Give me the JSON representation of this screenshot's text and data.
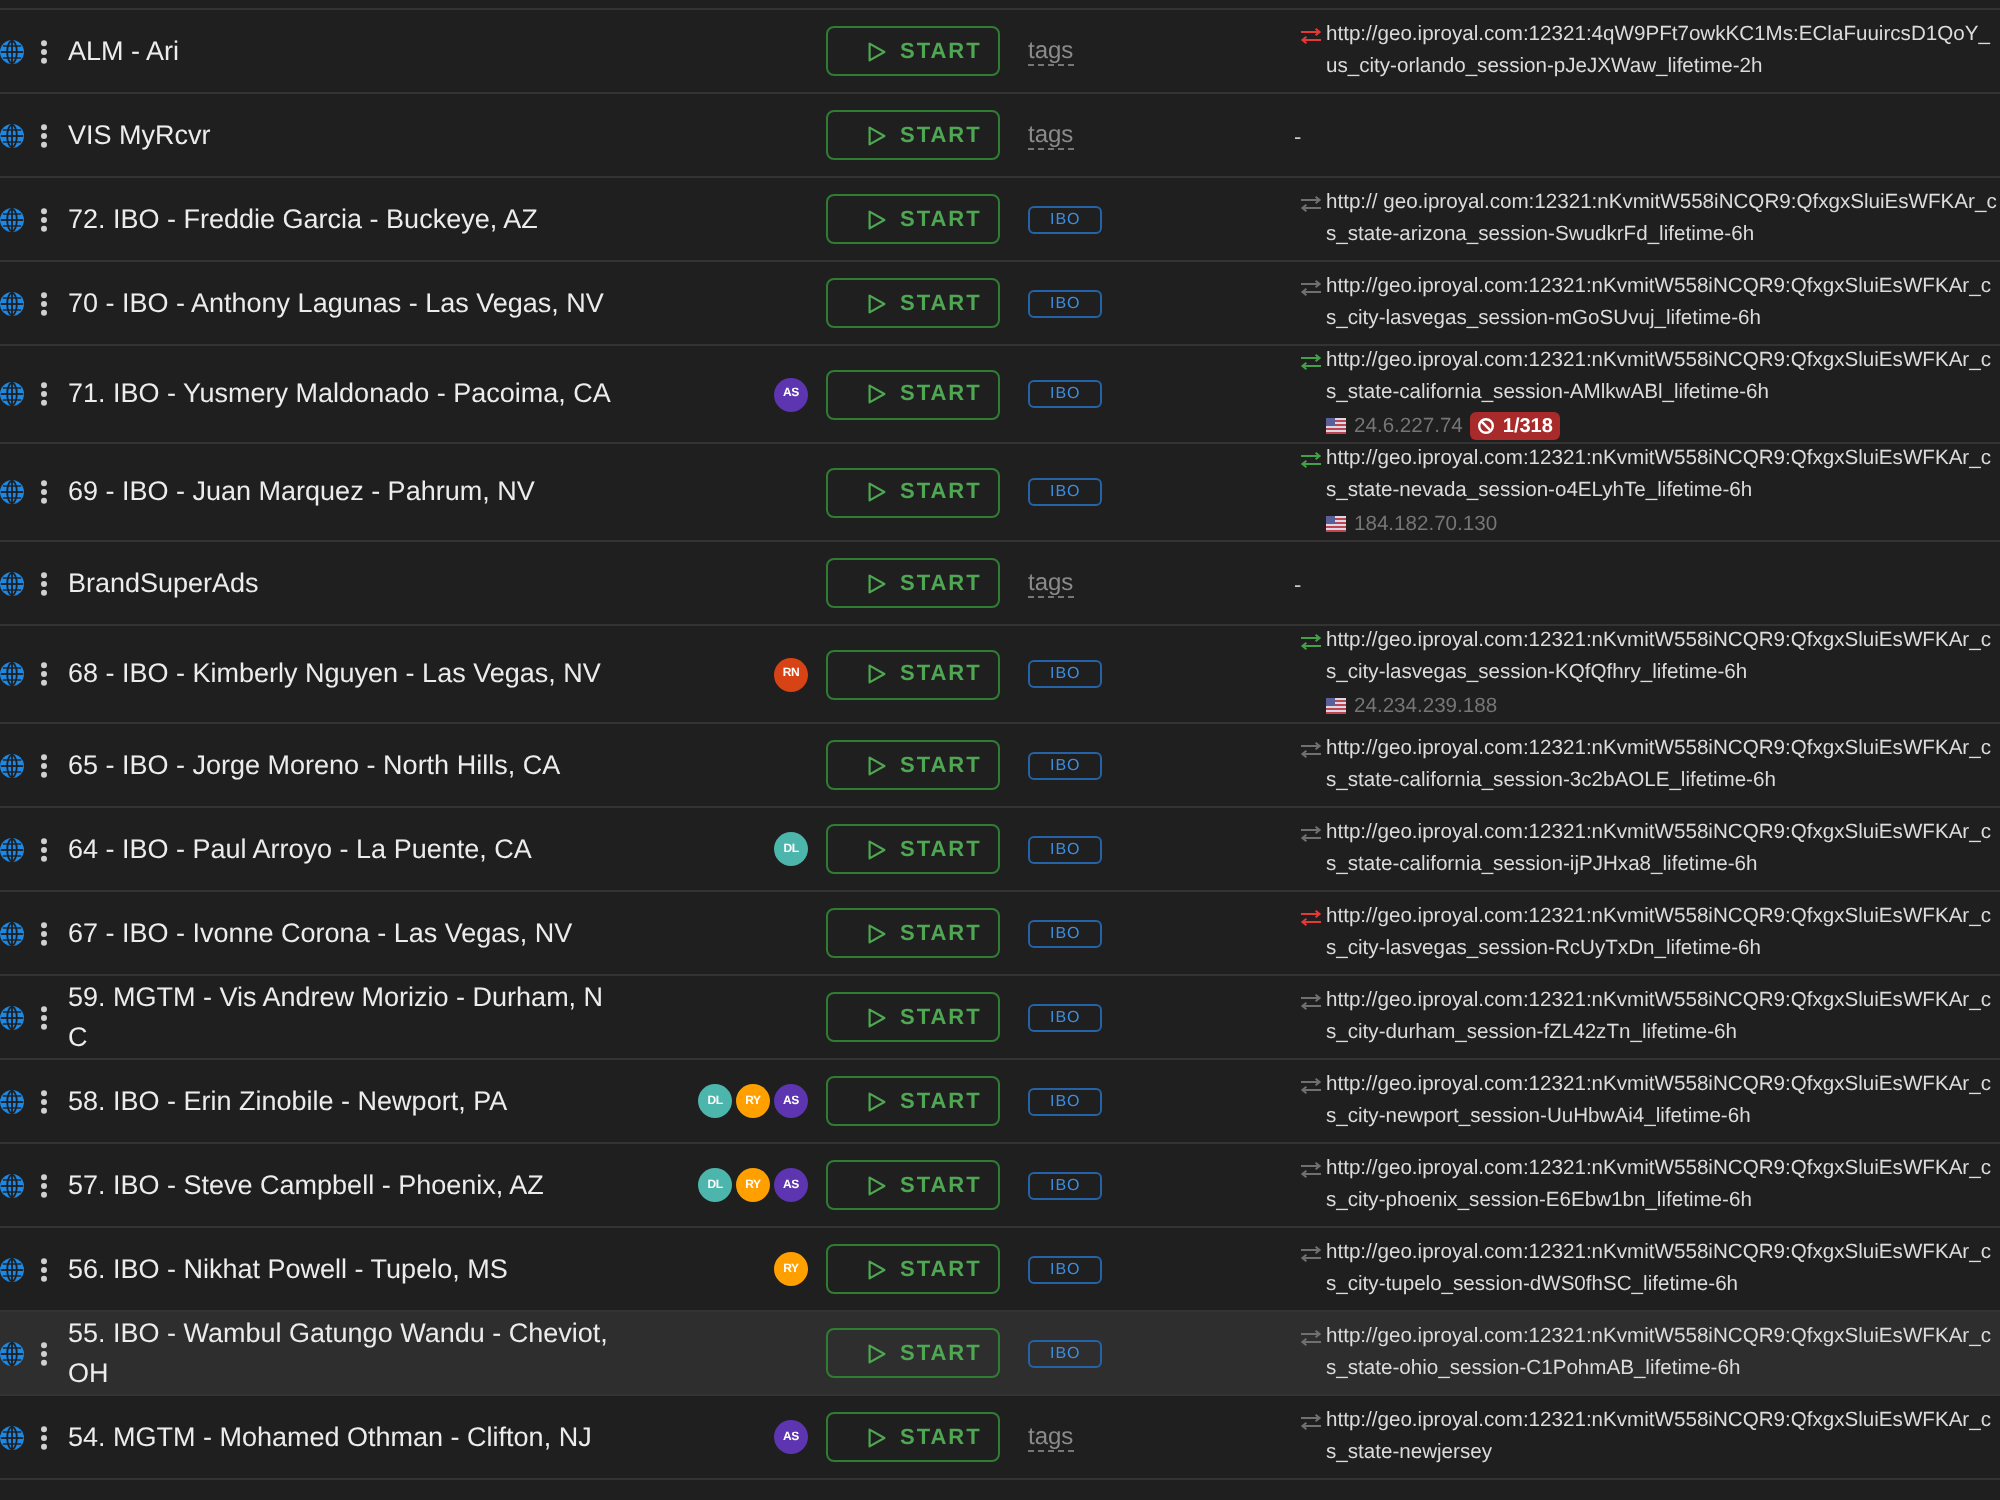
{
  "rows": [
    {
      "name": "ALM - Ari",
      "highlighted": false,
      "button": "START",
      "tags_hint": "tags",
      "proxy": {
        "color": "#e53935",
        "lines": [
          "http://geo.iproyal.com:12321:4qW9PFt7owkKC1Ms:EClaFuuircsD1QoY_",
          "us_city-orlando_session-pJeJXWaw_lifetime-2h"
        ]
      }
    },
    {
      "name": "VIS MyRcvr",
      "highlighted": false,
      "button": "START",
      "tags_hint": "tags",
      "proxy_text": "-"
    },
    {
      "name": "72. IBO - Freddie Garcia - Buckeye, AZ",
      "highlighted": false,
      "button": "START",
      "tags": [
        "IBO"
      ],
      "proxy": {
        "color": "#707070",
        "lines": [
          "http:// geo.iproyal.com:12321:nKvmitW558iNCQR9:QfxgxSluiEsWFKAr_c",
          "s_state-arizona_session-SwudkrFd_lifetime-6h"
        ]
      }
    },
    {
      "name": "70 - IBO - Anthony Lagunas - Las Vegas, NV",
      "highlighted": false,
      "button": "START",
      "tags": [
        "IBO"
      ],
      "proxy": {
        "color": "#707070",
        "lines": [
          "http://geo.iproyal.com:12321:nKvmitW558iNCQR9:QfxgxSluiEsWFKAr_c",
          "s_city-lasvegas_session-mGoSUvuj_lifetime-6h"
        ]
      }
    },
    {
      "name": "71. IBO - Yusmery Maldonado - Pacoima, CA",
      "highlighted": false,
      "avatars": [
        {
          "initials": "AS",
          "color": "#5e35b1"
        }
      ],
      "button": "START",
      "tags": [
        "IBO"
      ],
      "proxy": {
        "color": "#43a047",
        "lines": [
          "http://geo.iproyal.com:12321:nKvmitW558iNCQR9:QfxgxSluiEsWFKAr_c",
          "s_state-california_session-AMlkwABl_lifetime-6h"
        ],
        "ip": "24.6.227.74",
        "blocked": "1/318"
      }
    },
    {
      "name": "69 - IBO - Juan Marquez - Pahrum, NV",
      "highlighted": false,
      "button": "START",
      "tags": [
        "IBO"
      ],
      "proxy": {
        "color": "#43a047",
        "lines": [
          "http://geo.iproyal.com:12321:nKvmitW558iNCQR9:QfxgxSluiEsWFKAr_c",
          "s_state-nevada_session-o4ELyhTe_lifetime-6h"
        ],
        "ip": "184.182.70.130"
      }
    },
    {
      "name": "BrandSuperAds",
      "highlighted": false,
      "button": "START",
      "tags_hint": "tags",
      "proxy_text": "-"
    },
    {
      "name": "68 - IBO - Kimberly Nguyen - Las Vegas, NV",
      "highlighted": false,
      "avatars": [
        {
          "initials": "RN",
          "color": "#d84315"
        }
      ],
      "button": "START",
      "tags": [
        "IBO"
      ],
      "proxy": {
        "color": "#43a047",
        "lines": [
          "http://geo.iproyal.com:12321:nKvmitW558iNCQR9:QfxgxSluiEsWFKAr_c",
          "s_city-lasvegas_session-KQfQfhry_lifetime-6h"
        ],
        "ip": "24.234.239.188"
      }
    },
    {
      "name": "65 - IBO - Jorge Moreno - North Hills, CA",
      "highlighted": false,
      "button": "START",
      "tags": [
        "IBO"
      ],
      "proxy": {
        "color": "#707070",
        "lines": [
          "http://geo.iproyal.com:12321:nKvmitW558iNCQR9:QfxgxSluiEsWFKAr_c",
          "s_state-california_session-3c2bAOLE_lifetime-6h"
        ]
      }
    },
    {
      "name": "64 - IBO - Paul Arroyo - La Puente, CA",
      "highlighted": false,
      "avatars": [
        {
          "initials": "DL",
          "color": "#4db6ac"
        }
      ],
      "button": "START",
      "tags": [
        "IBO"
      ],
      "proxy": {
        "color": "#707070",
        "lines": [
          "http://geo.iproyal.com:12321:nKvmitW558iNCQR9:QfxgxSluiEsWFKAr_c",
          "s_state-california_session-ijPJHxa8_lifetime-6h"
        ]
      }
    },
    {
      "name": "67 - IBO - Ivonne Corona - Las Vegas, NV",
      "highlighted": false,
      "button": "START",
      "tags": [
        "IBO"
      ],
      "proxy": {
        "color": "#e53935",
        "lines": [
          "http://geo.iproyal.com:12321:nKvmitW558iNCQR9:QfxgxSluiEsWFKAr_c",
          "s_city-lasvegas_session-RcUyTxDn_lifetime-6h"
        ]
      }
    },
    {
      "name": "59. MGTM - Vis Andrew Morizio - Durham, NC",
      "highlighted": false,
      "button": "START",
      "tags": [
        "IBO"
      ],
      "proxy": {
        "color": "#707070",
        "lines": [
          "http://geo.iproyal.com:12321:nKvmitW558iNCQR9:QfxgxSluiEsWFKAr_c",
          "s_city-durham_session-fZL42zTn_lifetime-6h"
        ]
      }
    },
    {
      "name": "58. IBO - Erin Zinobile - Newport, PA",
      "highlighted": false,
      "avatars": [
        {
          "initials": "DL",
          "color": "#4db6ac"
        },
        {
          "initials": "RY",
          "color": "#ffa000"
        },
        {
          "initials": "AS",
          "color": "#5e35b1"
        }
      ],
      "button": "START",
      "tags": [
        "IBO"
      ],
      "proxy": {
        "color": "#707070",
        "lines": [
          "http://geo.iproyal.com:12321:nKvmitW558iNCQR9:QfxgxSluiEsWFKAr_c",
          "s_city-newport_session-UuHbwAi4_lifetime-6h"
        ]
      }
    },
    {
      "name": "57. IBO - Steve Campbell - Phoenix, AZ",
      "highlighted": false,
      "avatars": [
        {
          "initials": "DL",
          "color": "#4db6ac"
        },
        {
          "initials": "RY",
          "color": "#ffa000"
        },
        {
          "initials": "AS",
          "color": "#5e35b1"
        }
      ],
      "button": "START",
      "tags": [
        "IBO"
      ],
      "proxy": {
        "color": "#707070",
        "lines": [
          "http://geo.iproyal.com:12321:nKvmitW558iNCQR9:QfxgxSluiEsWFKAr_c",
          "s_city-phoenix_session-E6Ebw1bn_lifetime-6h"
        ]
      }
    },
    {
      "name": "56. IBO - Nikhat Powell - Tupelo, MS",
      "highlighted": false,
      "avatars": [
        {
          "initials": "RY",
          "color": "#ffa000"
        }
      ],
      "button": "START",
      "tags": [
        "IBO"
      ],
      "proxy": {
        "color": "#707070",
        "lines": [
          "http://geo.iproyal.com:12321:nKvmitW558iNCQR9:QfxgxSluiEsWFKAr_c",
          "s_city-tupelo_session-dWS0fhSC_lifetime-6h"
        ]
      }
    },
    {
      "name": "55. IBO - Wambul Gatungo Wandu - Cheviot, OH",
      "highlighted": true,
      "button": "START",
      "tags": [
        "IBO"
      ],
      "proxy": {
        "color": "#707070",
        "lines": [
          "http://geo.iproyal.com:12321:nKvmitW558iNCQR9:QfxgxSluiEsWFKAr_c",
          "s_state-ohio_session-C1PohmAB_lifetime-6h"
        ]
      }
    },
    {
      "name": "54. MGTM - Mohamed Othman - Clifton, NJ",
      "highlighted": false,
      "avatars": [
        {
          "initials": "AS",
          "color": "#5e35b1"
        }
      ],
      "button": "START",
      "tags_hint": "tags",
      "proxy": {
        "color": "#707070",
        "lines": [
          "http://geo.iproyal.com:12321:nKvmitW558iNCQR9:QfxgxSluiEsWFKAr_c",
          "s_state-newjersey"
        ]
      }
    }
  ]
}
